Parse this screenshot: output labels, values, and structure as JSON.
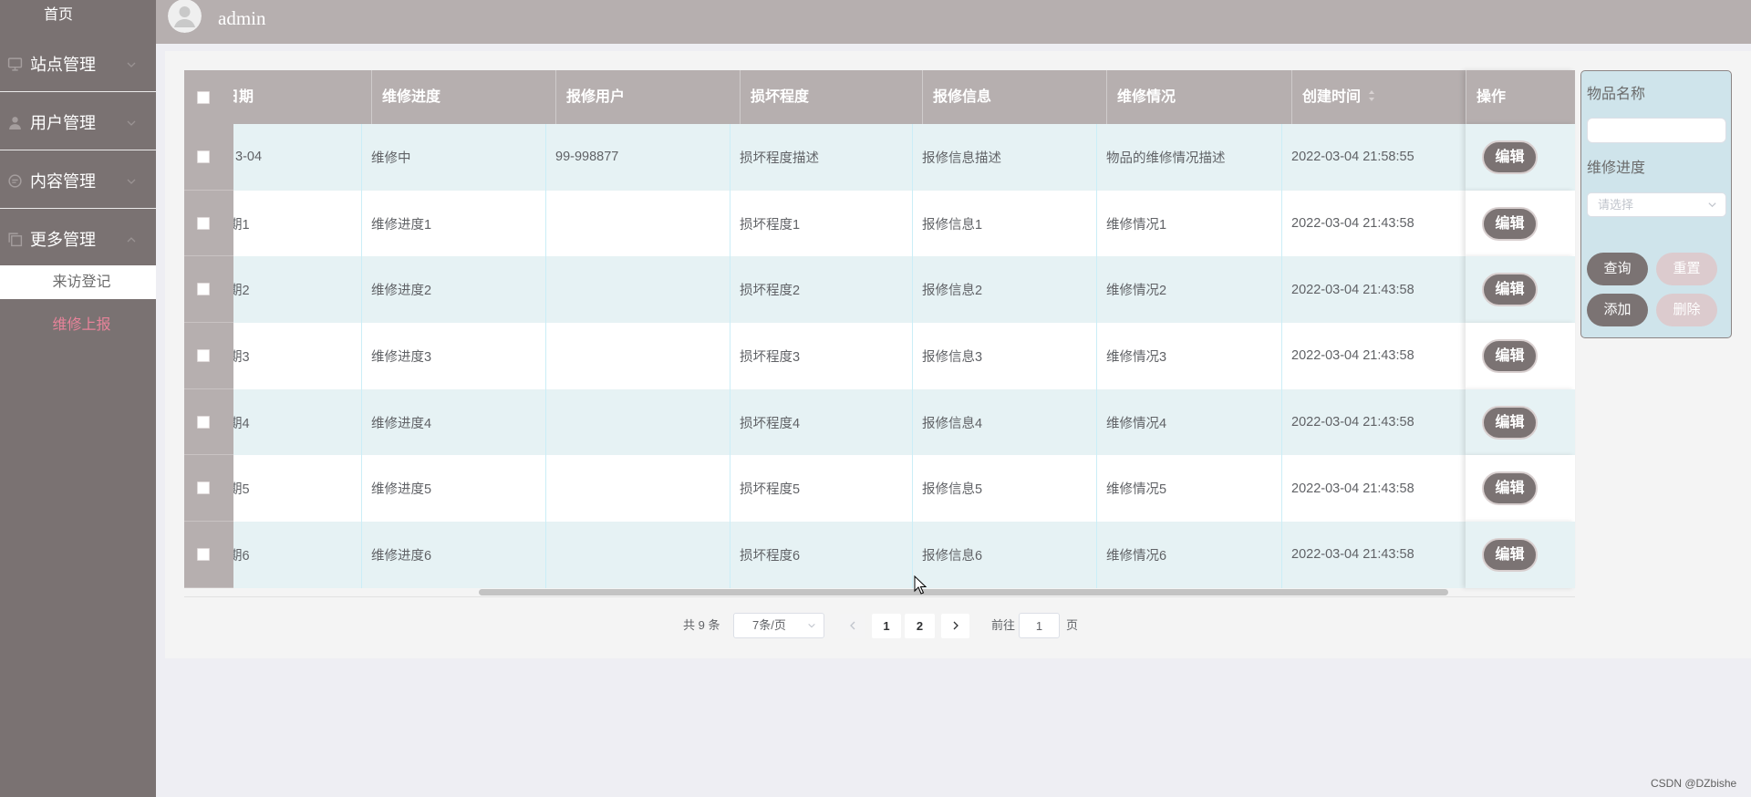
{
  "header": {
    "username": "admin",
    "avatar_icon": "avatar-icon"
  },
  "sidebar": {
    "home_label": "首页",
    "menus": [
      {
        "label": "站点管理",
        "icon": "monitor-icon",
        "expanded": false
      },
      {
        "label": "用户管理",
        "icon": "user-icon",
        "expanded": false
      },
      {
        "label": "内容管理",
        "icon": "message-icon",
        "expanded": false
      },
      {
        "label": "更多管理",
        "icon": "copy-icon",
        "expanded": true
      }
    ],
    "submenu": [
      {
        "label": "来访登记",
        "active": false
      },
      {
        "label": "维修上报",
        "active": true
      }
    ]
  },
  "table": {
    "columns": [
      "日期",
      "维修进度",
      "报修用户",
      "损坏程度",
      "报修信息",
      "维修情况",
      "创建时间",
      "操作"
    ],
    "sortable_column": "创建时间",
    "action_label": "编辑",
    "rows": [
      [
        "3-04",
        "维修中",
        "99-998877",
        "损坏程度描述",
        "报修信息描述",
        "物品的维修情况描述",
        "2022-03-04 21:58:55"
      ],
      [
        "期1",
        "维修进度1",
        "",
        "损坏程度1",
        "报修信息1",
        "维修情况1",
        "2022-03-04 21:43:58"
      ],
      [
        "期2",
        "维修进度2",
        "",
        "损坏程度2",
        "报修信息2",
        "维修情况2",
        "2022-03-04 21:43:58"
      ],
      [
        "期3",
        "维修进度3",
        "",
        "损坏程度3",
        "报修信息3",
        "维修情况3",
        "2022-03-04 21:43:58"
      ],
      [
        "期4",
        "维修进度4",
        "",
        "损坏程度4",
        "报修信息4",
        "维修情况4",
        "2022-03-04 21:43:58"
      ],
      [
        "期5",
        "维修进度5",
        "",
        "损坏程度5",
        "报修信息5",
        "维修情况5",
        "2022-03-04 21:43:58"
      ],
      [
        "期6",
        "维修进度6",
        "",
        "损坏程度6",
        "报修信息6",
        "维修情况6",
        "2022-03-04 21:43:58"
      ]
    ]
  },
  "filter": {
    "name_label": "物品名称",
    "name_value": "",
    "progress_label": "维修进度",
    "progress_placeholder": "请选择",
    "buttons": {
      "search": "查询",
      "reset": "重置",
      "add": "添加",
      "delete": "删除"
    }
  },
  "pagination": {
    "total_text": "共 9 条",
    "page_size": "7条/页",
    "prev_icon": "chevron-left-icon",
    "next_icon": "chevron-right-icon",
    "pages": [
      "1",
      "2"
    ],
    "current_page": 1,
    "goto_label": "前往",
    "goto_value": "1",
    "page_unit": "页"
  },
  "watermark": "CSDN @DZbishe",
  "colors": {
    "sidebar_bg": "#7a7272",
    "header_bg": "#b6afaf",
    "row_alt_bg": "#e6f2f4",
    "active_menu_text": "#e8839a",
    "button_dark": "#7b7373",
    "button_light": "#dccbce",
    "filter_bg": "#cfe4eb"
  }
}
